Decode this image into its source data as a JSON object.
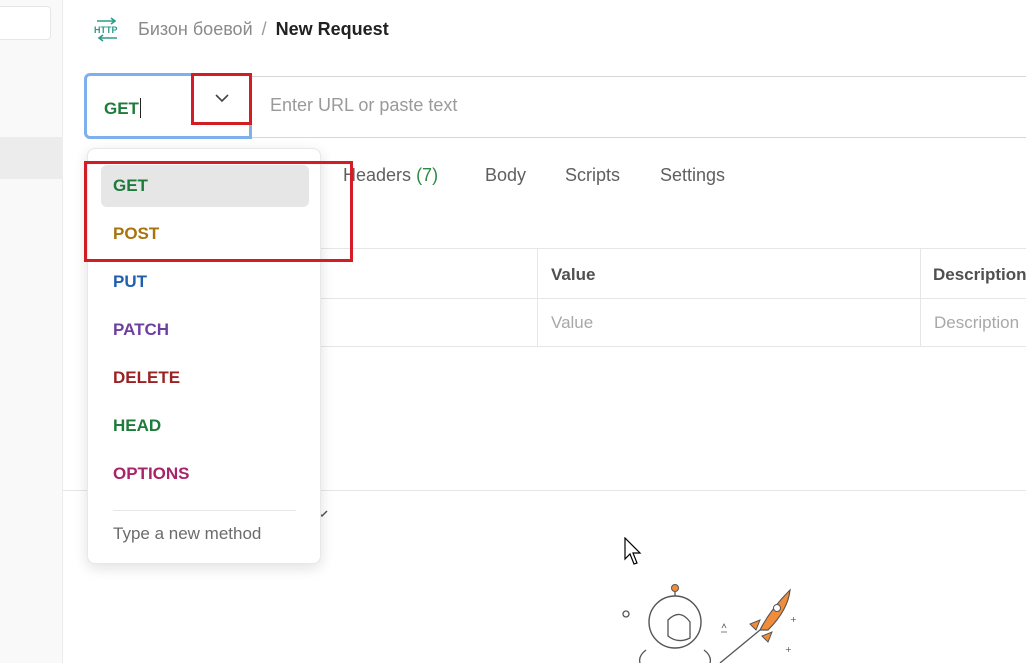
{
  "header": {
    "icon": "http-icon",
    "breadcrumb_parent": "Бизон боевой",
    "separator": "/",
    "title": "New Request"
  },
  "request": {
    "method": "GET",
    "url_placeholder": "Enter URL or paste text",
    "url_value": ""
  },
  "tabs": [
    {
      "label": "Headers",
      "count": "(7)"
    },
    {
      "label": "Body"
    },
    {
      "label": "Scripts"
    },
    {
      "label": "Settings"
    }
  ],
  "params_table": {
    "columns": [
      "Value",
      "Description"
    ],
    "placeholders": {
      "value": "Value",
      "description": "Description"
    }
  },
  "method_dropdown": {
    "selected": "GET",
    "options": [
      {
        "label": "GET",
        "color": "#1e7b3b"
      },
      {
        "label": "POST",
        "color": "#a8730a"
      },
      {
        "label": "PUT",
        "color": "#1f5fae"
      },
      {
        "label": "PATCH",
        "color": "#6f3fa0"
      },
      {
        "label": "DELETE",
        "color": "#9a2222"
      },
      {
        "label": "HEAD",
        "color": "#1e7b3b"
      },
      {
        "label": "OPTIONS",
        "color": "#a8246a"
      }
    ],
    "custom_method_placeholder": "Type a new method"
  },
  "colors": {
    "highlight": "#d11d23",
    "focus_ring": "#7fb0ec",
    "rocket_orange": "#f28c38"
  }
}
